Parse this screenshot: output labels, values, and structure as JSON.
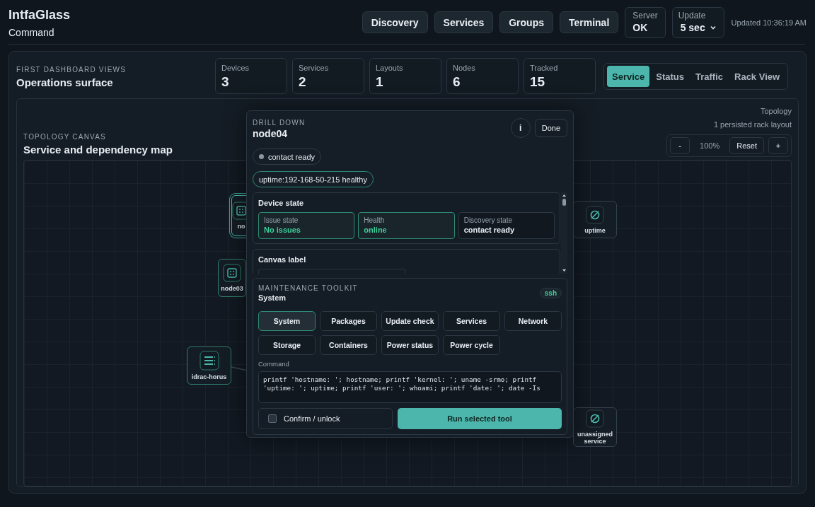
{
  "app": {
    "title": "IntfaGlass",
    "subtitle": "Command"
  },
  "nav": [
    {
      "label": "Discovery"
    },
    {
      "label": "Services"
    },
    {
      "label": "Groups"
    },
    {
      "label": "Terminal"
    }
  ],
  "server": {
    "label": "Server",
    "value": "OK"
  },
  "update": {
    "label": "Update",
    "value": "5 sec"
  },
  "updated": "Updated 10:36:19 AM",
  "overview": {
    "eyebrow": "FIRST DASHBOARD VIEWS",
    "title": "Operations surface"
  },
  "stats": [
    {
      "label": "Devices",
      "value": "3"
    },
    {
      "label": "Services",
      "value": "2"
    },
    {
      "label": "Layouts",
      "value": "1"
    },
    {
      "label": "Nodes",
      "value": "6"
    },
    {
      "label": "Tracked",
      "value": "15"
    }
  ],
  "view_tabs": [
    {
      "label": "Service",
      "selected": true
    },
    {
      "label": "Status",
      "selected": false
    },
    {
      "label": "Traffic",
      "selected": false
    },
    {
      "label": "Rack View",
      "selected": false
    }
  ],
  "topology": {
    "eyebrow": "TOPOLOGY CANVAS",
    "title": "Service and dependency map",
    "mode": "Topology",
    "layouts": "1 persisted rack layout",
    "zoom_out": "-",
    "zoom": "100%",
    "reset": "Reset",
    "zoom_in": "+"
  },
  "nodes": [
    {
      "label": "no",
      "kind": "server",
      "selected": true
    },
    {
      "label": "node03",
      "kind": "device",
      "selected": false
    },
    {
      "label": "idrac-horus",
      "kind": "rack",
      "selected": false
    },
    {
      "label": "uptime",
      "kind": "service",
      "selected": false
    },
    {
      "label": "unassigned service",
      "kind": "service",
      "selected": false
    }
  ],
  "drill": {
    "eyebrow": "DRILL DOWN",
    "title": "node04",
    "info": "i",
    "done": "Done",
    "chips": [
      {
        "text": "contact ready",
        "kind": "status"
      },
      {
        "text": "uptime:192-168-50-215 healthy",
        "kind": "check"
      }
    ],
    "device_state": {
      "title": "Device state",
      "fields": [
        {
          "label": "Issue state",
          "value": "No issues",
          "highlighted": true
        },
        {
          "label": "Health",
          "value": "online",
          "highlighted": true
        },
        {
          "label": "Discovery state",
          "value": "contact ready",
          "highlighted": false
        }
      ]
    },
    "canvas_label": {
      "title": "Canvas label"
    }
  },
  "toolkit": {
    "eyebrow": "MAINTENANCE TOOLKIT",
    "title": "System",
    "transport": "ssh",
    "tools": [
      {
        "label": "System",
        "selected": true
      },
      {
        "label": "Packages",
        "selected": false
      },
      {
        "label": "Update check",
        "selected": false
      },
      {
        "label": "Services",
        "selected": false
      },
      {
        "label": "Network",
        "selected": false
      },
      {
        "label": "Storage",
        "selected": false
      },
      {
        "label": "Containers",
        "selected": false
      },
      {
        "label": "Power status",
        "selected": false
      },
      {
        "label": "Power cycle",
        "selected": false
      }
    ],
    "command_label": "Command",
    "command": "printf 'hostname: '; hostname; printf 'kernel: '; uname -srmo; printf 'uptime: '; uptime; printf 'user: '; whoami; printf 'date: '; date -Is",
    "confirm": {
      "label": "Confirm / unlock",
      "checked": false
    },
    "run": "Run selected tool"
  }
}
